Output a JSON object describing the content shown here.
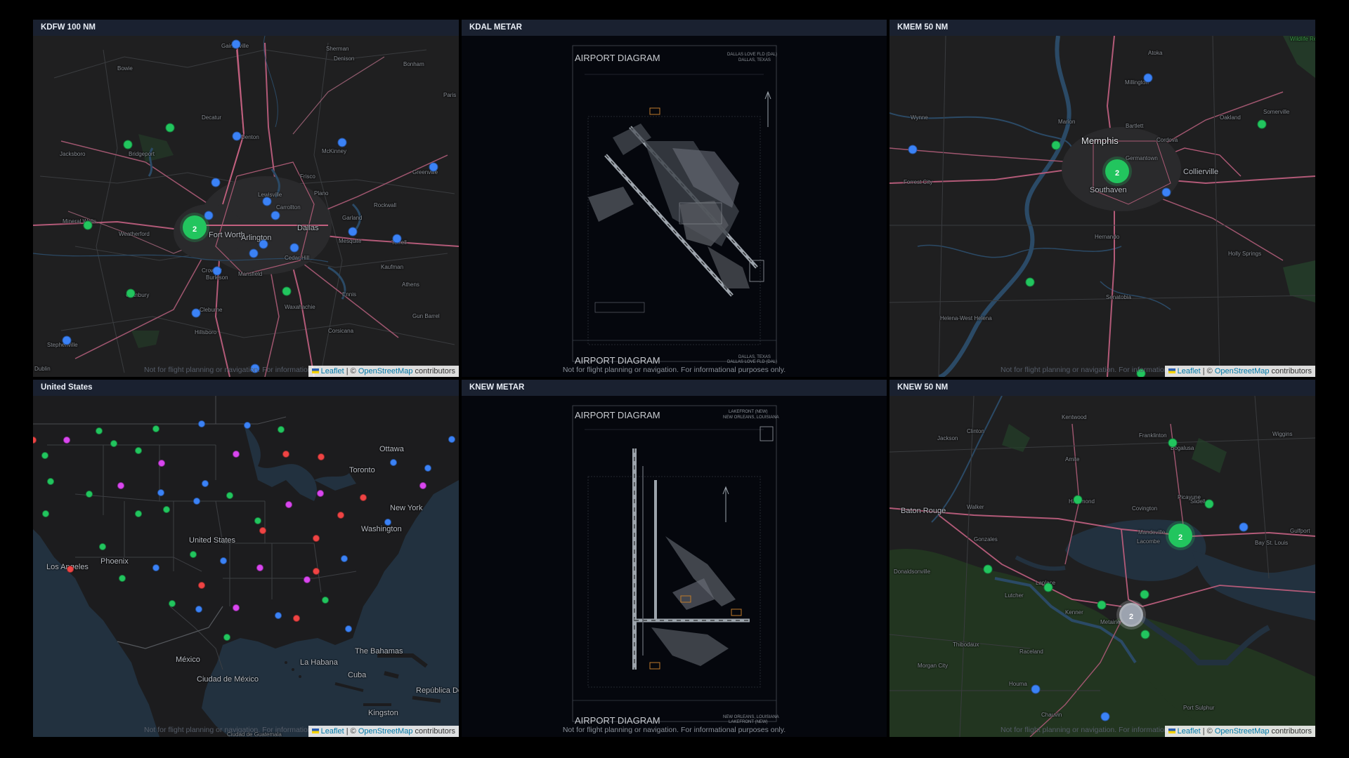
{
  "colors": {
    "vfr": "#22c55e",
    "mvfr": "#3b82f6",
    "ifr": "#ef4444",
    "lifr": "#d946ef",
    "unknown": "#9ca3af",
    "header_bg": "#1a2130",
    "water": "#22313f"
  },
  "attribution": {
    "leaflet": "Leaflet",
    "sep": " | © ",
    "osm": "OpenStreetMap",
    "contributors": " contributors"
  },
  "disclaimer": "Not for flight planning or navigation. For informational purposes only.",
  "panels": {
    "kdfw": {
      "title": "KDFW 100 NM",
      "cluster_count": "2",
      "labels": [
        "Gainesville",
        "Sherman",
        "Denison",
        "Bonham",
        "Paris",
        "Bowie",
        "Decatur",
        "Denton",
        "McKinney",
        "Greenville",
        "Jacksboro",
        "Bridgeport",
        "Frisco",
        "Plano",
        "Carrollton",
        "Lewisville",
        "Garland",
        "Rockwall",
        "Mesquite",
        "Mineral Wells",
        "Weatherford",
        "Fort Worth",
        "Arlington",
        "Dallas",
        "Cedar Hill",
        "Terrell",
        "Crowley",
        "Burleson",
        "Mansfield",
        "Waxahachie",
        "Ennis",
        "Cleburne",
        "Hillsboro",
        "Stephenville",
        "Corsicana",
        "Athens",
        "Kaufman",
        "Gun Barrel",
        "Dublin",
        "Granbury"
      ]
    },
    "kdal": {
      "title": "KDAL METAR",
      "diagram_title": "AIRPORT DIAGRAM",
      "airport_name": "DALLAS LOVE FLD (DAL)",
      "city": "DALLAS, TEXAS"
    },
    "kmem": {
      "title": "KMEM 50 NM",
      "cluster_count": "2",
      "labels": [
        "Atoka",
        "Millington",
        "Wynne",
        "Marion",
        "Memphis",
        "Bartlett",
        "Oakland",
        "Somerville",
        "Cordova",
        "Germantown",
        "Collierville",
        "Forrest City",
        "Southaven",
        "Hernando",
        "Holly Springs",
        "Senatobia",
        "Helena-West Helena",
        "Wildlife Refuge"
      ]
    },
    "us": {
      "title": "United States",
      "labels": [
        "Ottawa",
        "Toronto",
        "New York",
        "Washington",
        "United States",
        "Los Angeles",
        "Phoenix",
        "México",
        "Ciudad de México",
        "La Habana",
        "The Bahamas",
        "Cuba",
        "República Dominicana",
        "Kingston",
        "Ciudad de Guatemala"
      ]
    },
    "knew": {
      "title": "KNEW METAR",
      "diagram_title": "AIRPORT DIAGRAM",
      "airport_name": "LAKEFRONT (NEW)",
      "city": "NEW ORLEANS, LOUISIANA"
    },
    "knew50": {
      "title": "KNEW 50 NM",
      "cluster_green": "2",
      "cluster_grey": "2",
      "labels": [
        "Kentwood",
        "Franklinton",
        "Clinton",
        "Jackson",
        "Amite",
        "Bogalusa",
        "Baton Rouge",
        "Walker",
        "Hammond",
        "Covington",
        "Slidell",
        "Gonzales",
        "Mandeville",
        "Lacombe",
        "Donaldsonville",
        "Laplace",
        "Lutcher",
        "Kenner",
        "Metairie",
        "Thibodaux",
        "Houma",
        "Raceland",
        "Morgan City",
        "Chauvin",
        "Port Sulphur",
        "Picayune",
        "Bay St. Louis",
        "Gulfport",
        "Wiggins"
      ]
    }
  }
}
